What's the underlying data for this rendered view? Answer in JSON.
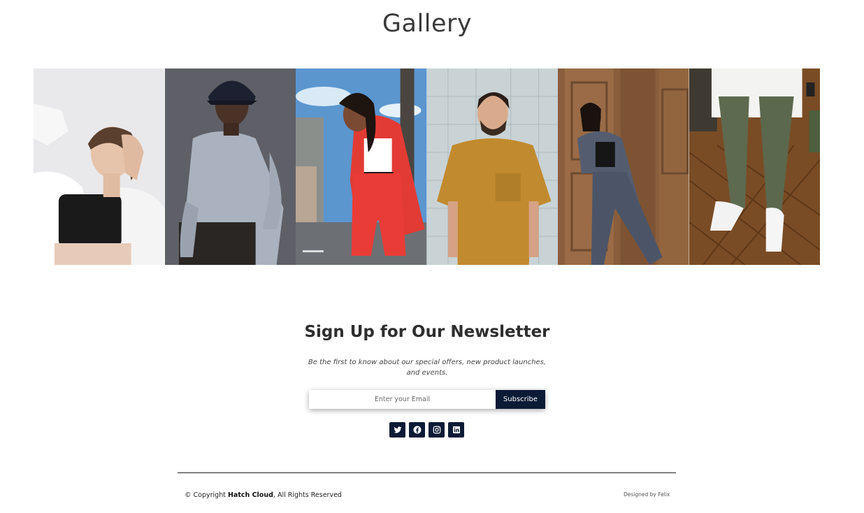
{
  "gallery": {
    "title": "Gallery",
    "photos": [
      {
        "name": "photo-woman-white-shirt"
      },
      {
        "name": "photo-man-bucket-hat"
      },
      {
        "name": "photo-woman-red-suit"
      },
      {
        "name": "photo-man-mustard-tee"
      },
      {
        "name": "photo-woman-grey-suit"
      },
      {
        "name": "photo-sneakers-wood-floor"
      }
    ]
  },
  "newsletter": {
    "heading": "Sign Up for Our Newsletter",
    "description": "Be the first to know about our special offers, new product launches, and events.",
    "email_placeholder": "Enter your Email",
    "subscribe_label": "Subscribe"
  },
  "socials": [
    {
      "icon": "twitter-icon"
    },
    {
      "icon": "facebook-icon"
    },
    {
      "icon": "instagram-icon"
    },
    {
      "icon": "linkedin-icon"
    }
  ],
  "footer": {
    "copyright_prefix": "© Copyright ",
    "brand": "Hatch Cloud",
    "copyright_suffix": ", All Rights Reserved",
    "designed_by": "Designed by Felix"
  },
  "colors": {
    "accent": "#0b1a35",
    "text": "#333333"
  }
}
